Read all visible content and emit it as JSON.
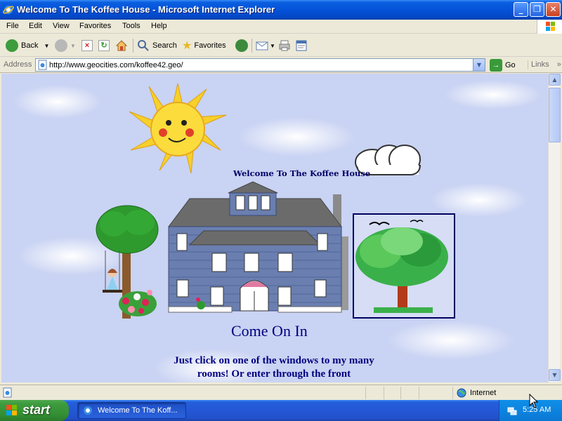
{
  "window": {
    "title": "Welcome To The Koffee House - Microsoft Internet Explorer",
    "controls": {
      "minimize": "_",
      "maximize": "❐",
      "close": "✕"
    }
  },
  "menu": [
    "File",
    "Edit",
    "View",
    "Favorites",
    "Tools",
    "Help"
  ],
  "toolbar": {
    "back_label": "Back",
    "search_label": "Search",
    "favorites_label": "Favorites"
  },
  "address": {
    "label": "Address",
    "url": "http://www.geocities.com/koffee42.geo/",
    "go_label": "Go",
    "links_label": "Links"
  },
  "page": {
    "welcome": "Welcome To The Koffee House",
    "heading": "Come On In",
    "instruction": "Just click on one of the windows to my many rooms! Or enter through the front"
  },
  "status": {
    "zone": "Internet"
  },
  "taskbar": {
    "start_label": "start",
    "task_title": "Welcome To The Koff...",
    "clock": "5:25 AM"
  },
  "colors": {
    "title_bar": "#0553d8",
    "page_background": "#c9d3f3",
    "page_text": "#000080",
    "taskbar": "#245edb",
    "start_button": "#3c9b3c"
  }
}
